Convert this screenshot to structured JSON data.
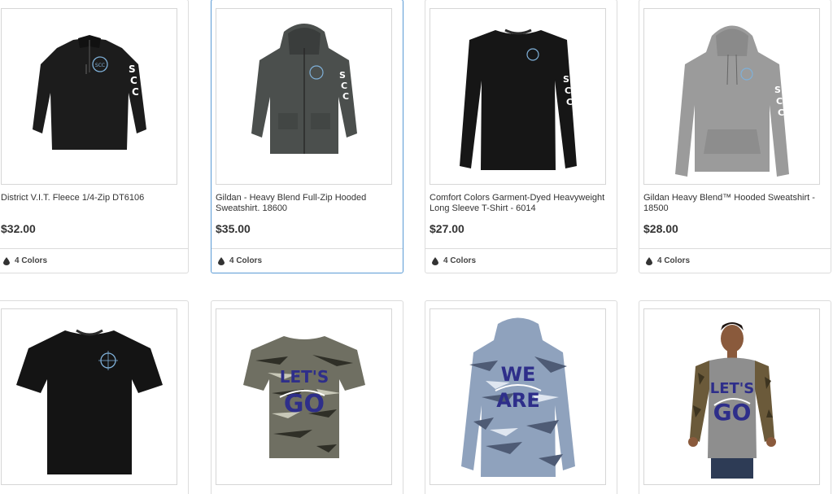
{
  "products_row1": [
    {
      "title": "District V.I.T. Fleece 1/4-Zip DT6106",
      "price": "$32.00",
      "colors": "4 Colors",
      "image": "black-quarter-zip-fleece"
    },
    {
      "title": "Gildan - Heavy Blend Full-Zip Hooded Sweatshirt. 18600",
      "price": "$35.00",
      "colors": "4 Colors",
      "image": "charcoal-full-zip-hoodie"
    },
    {
      "title": "Comfort Colors Garment-Dyed Heavyweight Long Sleeve T-Shirt - 6014",
      "price": "$27.00",
      "colors": "4 Colors",
      "image": "black-long-sleeve-tee"
    },
    {
      "title": "Gildan Heavy Blend™ Hooded Sweatshirt - 18500",
      "price": "$28.00",
      "colors": "4 Colors",
      "image": "grey-pullover-hoodie"
    }
  ],
  "products_row2": [
    {
      "image": "black-short-sleeve-tee"
    },
    {
      "image": "camo-tee-lets-go"
    },
    {
      "image": "blue-camo-hoodie-we-are"
    },
    {
      "image": "model-camo-raglan-lets-go"
    }
  ],
  "graphics": {
    "sleeve_text": "SCC",
    "logo_text": "SCC",
    "lets_go_1": "LET'S",
    "lets_go_2": "GO",
    "we_are_1": "WE",
    "we_are_2": "ARE"
  },
  "colors": {
    "border": "#dcdcdc",
    "active_border": "#5b9bd5",
    "logo_blue": "#7fb0d8",
    "print_navy": "#2e2e8a"
  }
}
